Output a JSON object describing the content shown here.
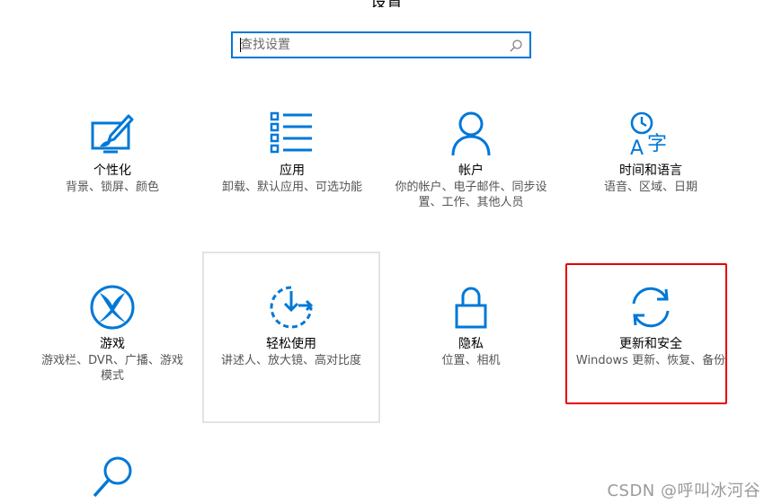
{
  "window": {
    "title": "设置"
  },
  "search": {
    "placeholder": "查找设置",
    "value": ""
  },
  "tiles": [
    {
      "id": "personalization",
      "title": "个性化",
      "desc": "背景、锁屏、颜色",
      "icon": "personalization-icon"
    },
    {
      "id": "apps",
      "title": "应用",
      "desc": "卸载、默认应用、可选功能",
      "icon": "apps-list-icon"
    },
    {
      "id": "accounts",
      "title": "帐户",
      "desc": "你的帐户、电子邮件、同步设置、工作、其他人员",
      "icon": "user-icon"
    },
    {
      "id": "time-language",
      "title": "时间和语言",
      "desc": "语音、区域、日期",
      "icon": "time-language-icon"
    },
    {
      "id": "gaming",
      "title": "游戏",
      "desc": "游戏栏、DVR、广播、游戏模式",
      "icon": "xbox-icon"
    },
    {
      "id": "ease-of-access",
      "title": "轻松使用",
      "desc": "讲述人、放大镜、高对比度",
      "icon": "ease-of-access-icon"
    },
    {
      "id": "privacy",
      "title": "隐私",
      "desc": "位置、相机",
      "icon": "lock-icon"
    },
    {
      "id": "update-security",
      "title": "更新和安全",
      "desc": "Windows 更新、恢复、备份",
      "icon": "sync-icon"
    },
    {
      "id": "search-tile",
      "title": "",
      "desc": "",
      "icon": "search-magnifier-icon"
    }
  ],
  "colors": {
    "accent": "#0078d7",
    "highlight": "#e60000",
    "hover_border": "#e3e3e3"
  },
  "watermark": "CSDN @呼叫冰河谷"
}
